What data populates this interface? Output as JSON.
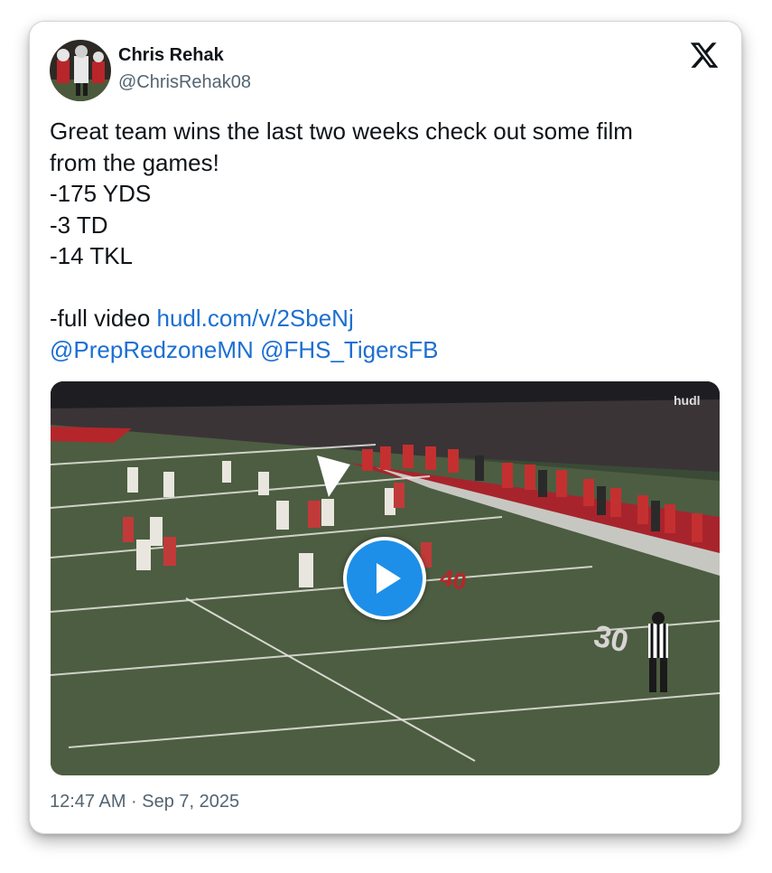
{
  "author": {
    "name": "Chris Rehak",
    "handle": "@ChrisRehak08"
  },
  "brand_icon": "x-logo-icon",
  "tweet": {
    "line1": "Great team wins the last two weeks check out some film",
    "line2": "from the games!",
    "stat1": "-175 YDS",
    "stat2": "-3 TD",
    "stat3": "-14 TKL",
    "video_prefix": "-full video ",
    "video_link": "hudl.com/v/2SbeNj",
    "mention1": "@PrepRedzoneMN",
    "mention2": "@FHS_TigersFB"
  },
  "media": {
    "watermark": "hudl",
    "field_number": "30",
    "play_icon": "play-icon"
  },
  "timestamp": "12:47 AM · Sep 7, 2025",
  "colors": {
    "link": "#1d6fd1",
    "play_button": "#1d8fe8",
    "text": "#0f1419",
    "muted": "#536471"
  }
}
